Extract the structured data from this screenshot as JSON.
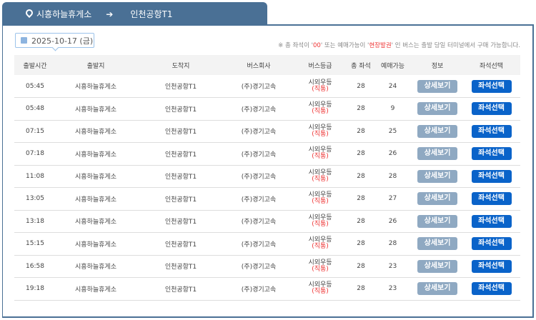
{
  "route": {
    "from": "시흥하늘휴게소",
    "arrow": "➔",
    "to": "인천공항T1"
  },
  "date": "2025-10-17 (금)",
  "notice": {
    "p1": "※ 총 좌석이 '",
    "hl1": "00",
    "p2": "' 또는 예매가능이 '",
    "hl2": "현장발권",
    "p3": "' 인 버스는 출발 당일 터미널에서 구매 가능합니다."
  },
  "headers": [
    "출발시간",
    "출발지",
    "도착지",
    "버스회사",
    "버스등급",
    "총 좌석",
    "예매가능",
    "정보",
    "좌석선택"
  ],
  "rows": [
    {
      "time": "05:45",
      "from": "시흥하늘휴게소",
      "to": "인천공항T1",
      "company": "(주)경기고속",
      "grade": "시외우등",
      "grade_sub": "(직통)",
      "total": "28",
      "avail": "24"
    },
    {
      "time": "05:48",
      "from": "시흥하늘휴게소",
      "to": "인천공항T1",
      "company": "(주)경기고속",
      "grade": "시외우등",
      "grade_sub": "(직통)",
      "total": "28",
      "avail": "9"
    },
    {
      "time": "07:15",
      "from": "시흥하늘휴게소",
      "to": "인천공항T1",
      "company": "(주)경기고속",
      "grade": "시외우등",
      "grade_sub": "(직통)",
      "total": "28",
      "avail": "25"
    },
    {
      "time": "07:18",
      "from": "시흥하늘휴게소",
      "to": "인천공항T1",
      "company": "(주)경기고속",
      "grade": "시외우등",
      "grade_sub": "(직통)",
      "total": "28",
      "avail": "26"
    },
    {
      "time": "11:08",
      "from": "시흥하늘휴게소",
      "to": "인천공항T1",
      "company": "(주)경기고속",
      "grade": "시외우등",
      "grade_sub": "(직통)",
      "total": "28",
      "avail": "28"
    },
    {
      "time": "13:05",
      "from": "시흥하늘휴게소",
      "to": "인천공항T1",
      "company": "(주)경기고속",
      "grade": "시외우등",
      "grade_sub": "(직통)",
      "total": "28",
      "avail": "27"
    },
    {
      "time": "13:18",
      "from": "시흥하늘휴게소",
      "to": "인천공항T1",
      "company": "(주)경기고속",
      "grade": "시외우등",
      "grade_sub": "(직통)",
      "total": "28",
      "avail": "26"
    },
    {
      "time": "15:15",
      "from": "시흥하늘휴게소",
      "to": "인천공항T1",
      "company": "(주)경기고속",
      "grade": "시외우등",
      "grade_sub": "(직통)",
      "total": "28",
      "avail": "28"
    },
    {
      "time": "16:58",
      "from": "시흥하늘휴게소",
      "to": "인천공항T1",
      "company": "(주)경기고속",
      "grade": "시외우등",
      "grade_sub": "(직통)",
      "total": "28",
      "avail": "23"
    },
    {
      "time": "19:18",
      "from": "시흥하늘휴게소",
      "to": "인천공항T1",
      "company": "(주)경기고속",
      "grade": "시외우등",
      "grade_sub": "(직통)",
      "total": "28",
      "avail": "23"
    }
  ],
  "buttons": {
    "detail": "상세보기",
    "select": "좌석선택"
  }
}
